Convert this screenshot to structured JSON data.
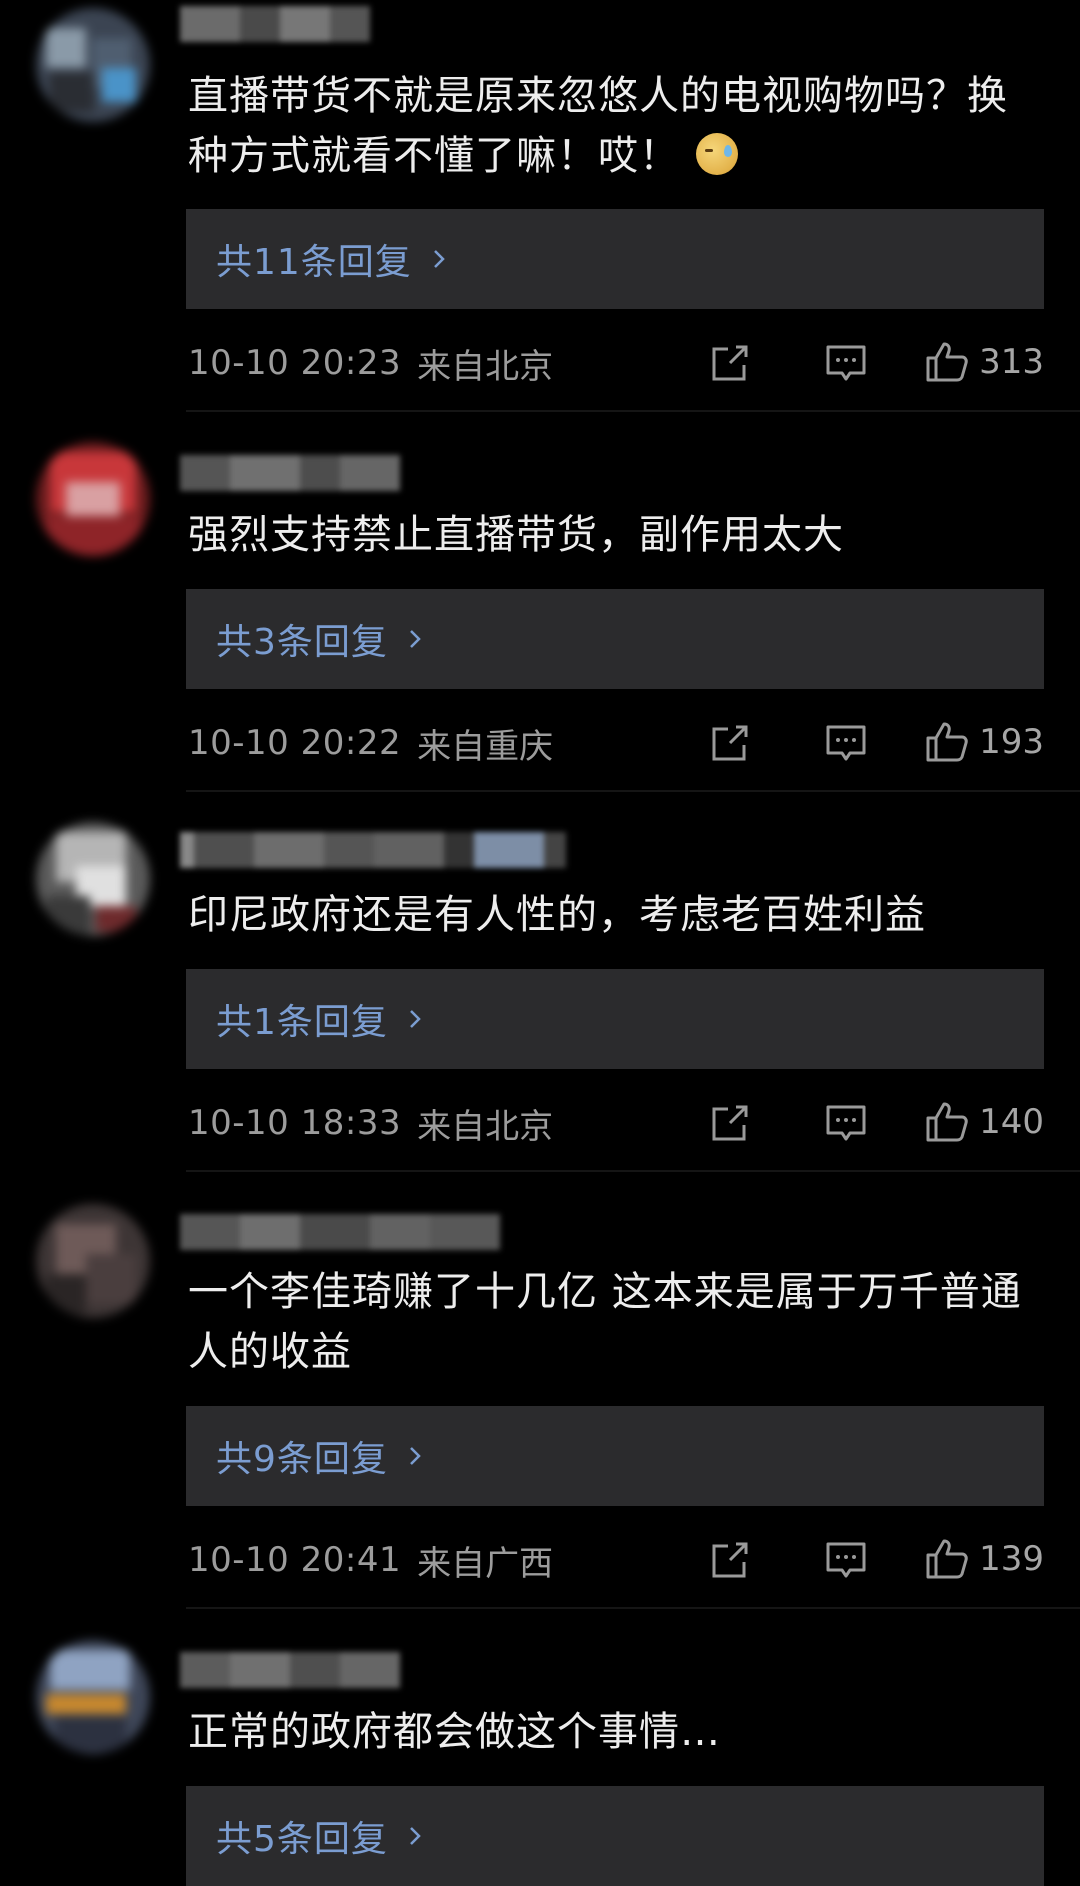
{
  "comments": [
    {
      "text": "直播带货不就是原来忽悠人的电视购物吗？换种方式就看不懂了嘛！哎！",
      "emoji": "sweat-emoji",
      "replies_label": "共11条回复",
      "time": "10-10 20:23",
      "location": "来自北京",
      "likes": "313"
    },
    {
      "text": "强烈支持禁止直播带货，副作用太大",
      "replies_label": "共3条回复",
      "time": "10-10 20:22",
      "location": "来自重庆",
      "likes": "193"
    },
    {
      "text": "印尼政府还是有人性的，考虑老百姓利益",
      "replies_label": "共1条回复",
      "time": "10-10 18:33",
      "location": "来自北京",
      "likes": "140"
    },
    {
      "text": "一个李佳琦赚了十几亿  这本来是属于万千普通人的收益",
      "replies_label": "共9条回复",
      "time": "10-10 20:41",
      "location": "来自广西",
      "likes": "139"
    },
    {
      "text": "正常的政府都会做这个事情…",
      "replies_label": "共5条回复"
    }
  ],
  "icons": {
    "share": "share-icon",
    "comment": "comment-icon",
    "like": "thumbs-up-icon",
    "chevron": "chevron-right-icon"
  },
  "colors": {
    "background": "#000000",
    "reply_box": "#2b2b2d",
    "reply_link": "#7b9dd1",
    "meta_text": "#9c9c9c"
  }
}
